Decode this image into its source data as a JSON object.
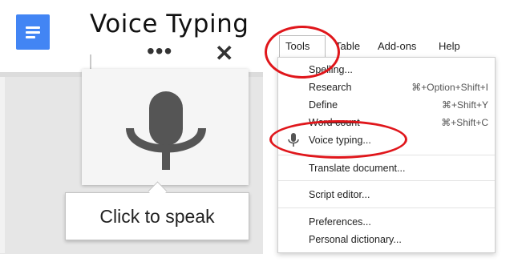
{
  "left_panel": {
    "title": "Voice Typing",
    "more_glyph": "•••",
    "close_glyph": "✕",
    "tooltip": "Click to speak",
    "icons": {
      "app": "docs-icon",
      "mic": "microphone-icon"
    },
    "colors": {
      "docs_blue": "#4285f4",
      "mic_gray": "#555555",
      "panel_gray": "#e6e6e6"
    }
  },
  "menubar": {
    "items": [
      "Tools",
      "Table",
      "Add-ons",
      "Help"
    ]
  },
  "tools_menu": {
    "items": [
      {
        "label": "Spelling...",
        "shortcut": ""
      },
      {
        "label": "Research",
        "shortcut": "⌘+Option+Shift+I"
      },
      {
        "label": "Define",
        "shortcut": "⌘+Shift+Y"
      },
      {
        "label": "Word count",
        "shortcut": "⌘+Shift+C"
      },
      {
        "label": "Voice typing...",
        "shortcut": ""
      },
      {
        "label": "Translate document...",
        "shortcut": ""
      },
      {
        "label": "Script editor...",
        "shortcut": ""
      },
      {
        "label": "Preferences...",
        "shortcut": ""
      },
      {
        "label": "Personal dictionary...",
        "shortcut": ""
      }
    ]
  },
  "annotations": {
    "color": "#e0161b"
  }
}
